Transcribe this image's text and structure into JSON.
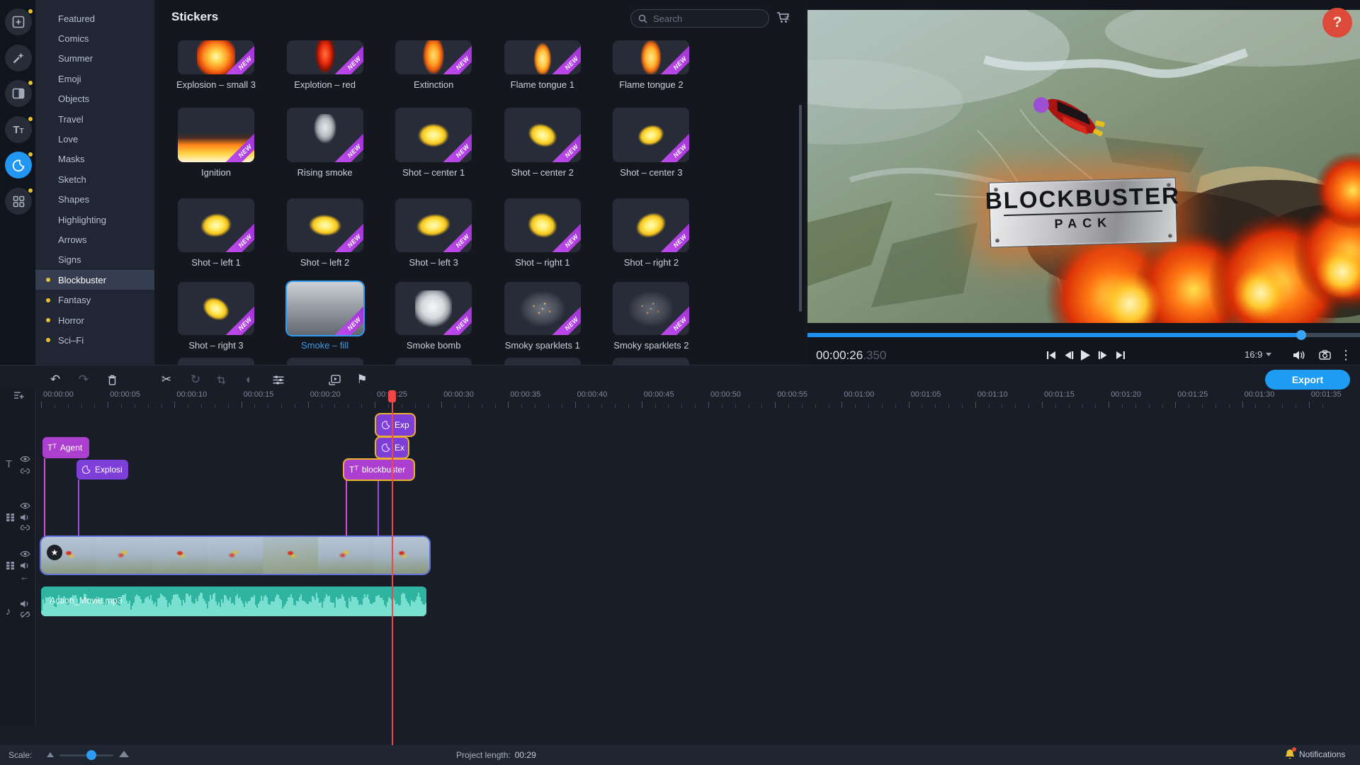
{
  "left_toolbar": {
    "items": [
      {
        "icon": "import-media-icon",
        "selected": false,
        "dot": true
      },
      {
        "icon": "filters-icon",
        "selected": false,
        "dot": false
      },
      {
        "icon": "transitions-icon",
        "selected": false,
        "dot": true
      },
      {
        "icon": "titles-icon",
        "selected": false,
        "dot": true
      },
      {
        "icon": "stickers-icon",
        "selected": true,
        "dot": true
      },
      {
        "icon": "more-tools-icon",
        "selected": false,
        "dot": true
      }
    ]
  },
  "categories": [
    {
      "label": "Featured"
    },
    {
      "label": "Comics"
    },
    {
      "label": "Summer"
    },
    {
      "label": "Emoji"
    },
    {
      "label": "Objects"
    },
    {
      "label": "Travel"
    },
    {
      "label": "Love"
    },
    {
      "label": "Masks"
    },
    {
      "label": "Sketch"
    },
    {
      "label": "Shapes"
    },
    {
      "label": "Highlighting"
    },
    {
      "label": "Arrows"
    },
    {
      "label": "Signs"
    },
    {
      "label": "Blockbuster",
      "dot": true,
      "selected": true
    },
    {
      "label": "Fantasy",
      "dot": true
    },
    {
      "label": "Horror",
      "dot": true
    },
    {
      "label": "Sci–Fi",
      "dot": true
    }
  ],
  "stickers": {
    "title": "Stickers",
    "search_placeholder": "Search",
    "new_badge": "NEW",
    "items": [
      {
        "label": "Explosion – small 3",
        "art": "fireball",
        "new": true
      },
      {
        "label": "Explotion – red",
        "art": "flame-red",
        "new": true
      },
      {
        "label": "Extinction",
        "art": "flame-column",
        "new": true
      },
      {
        "label": "Flame tongue 1",
        "art": "flame-tongue",
        "new": true
      },
      {
        "label": "Flame tongue 2",
        "art": "flame-tongue2",
        "new": true
      },
      {
        "label": "Ignition",
        "art": "ignition",
        "new": true
      },
      {
        "label": "Rising smoke",
        "art": "smoke-rise",
        "new": true
      },
      {
        "label": "Shot – center 1",
        "art": "shot1",
        "new": true
      },
      {
        "label": "Shot – center 2",
        "art": "shot2",
        "new": true
      },
      {
        "label": "Shot – center 3",
        "art": "shot3",
        "new": true
      },
      {
        "label": "Shot – left 1",
        "art": "shot4",
        "new": true
      },
      {
        "label": "Shot – left 2",
        "art": "shot5",
        "new": true
      },
      {
        "label": "Shot – left 3",
        "art": "shot6",
        "new": true
      },
      {
        "label": "Shot – right 1",
        "art": "shot7",
        "new": true
      },
      {
        "label": "Shot – right 2",
        "art": "shot8",
        "new": true
      },
      {
        "label": "Shot – right 3",
        "art": "shot9",
        "new": true
      },
      {
        "label": "Smoke – fill",
        "art": "smoke-fill",
        "new": true,
        "selected": true
      },
      {
        "label": "Smoke bomb",
        "art": "smoke-bomb",
        "new": true
      },
      {
        "label": "Smoky sparklets 1",
        "art": "sparklets",
        "new": true
      },
      {
        "label": "Smoky sparklets 2",
        "art": "sparklets2",
        "new": true
      }
    ]
  },
  "preview": {
    "plate_title": "BLOCKBUSTER",
    "plate_subtitle": "PACK",
    "help_label": "?",
    "timecode": "00:00:26",
    "timecode_ms": ".350",
    "aspect": "16:9"
  },
  "toolbar": {
    "export_label": "Export"
  },
  "timeline": {
    "ruler_labels": [
      "00:00:00",
      "00:00:05",
      "00:00:10",
      "00:00:15",
      "00:00:20",
      "00:00:25",
      "00:00:30",
      "00:00:35",
      "00:00:40",
      "00:00:45",
      "00:00:50",
      "00:00:55",
      "00:01:00",
      "00:01:05",
      "00:01:10",
      "00:01:15",
      "00:01:20",
      "00:01:25",
      "00:01:30",
      "00:01:35"
    ],
    "clips": {
      "exp": {
        "label": "Exp"
      },
      "ex": {
        "label": "Ex"
      },
      "agent": {
        "label": "Agent"
      },
      "blockbuster": {
        "label": "blockbuster"
      },
      "explosi": {
        "label": "Explosi"
      },
      "audio": {
        "label": "Action_Movie.mp3"
      }
    }
  },
  "bottom_bar": {
    "scale_label": "Scale:",
    "project_length_label": "Project length:",
    "project_length_value": "00:29",
    "notifications_label": "Notifications"
  },
  "colors": {
    "accent_blue": "#2196f3",
    "selection_yellow": "#ecb02f",
    "playhead_red": "#ef4747",
    "audio_teal": "#2fb4a1",
    "new_ribbon_purple": "#b53be0",
    "clip_sticker_purple": "#7e3fd8",
    "clip_title_magenta": "#ad3fd0"
  }
}
